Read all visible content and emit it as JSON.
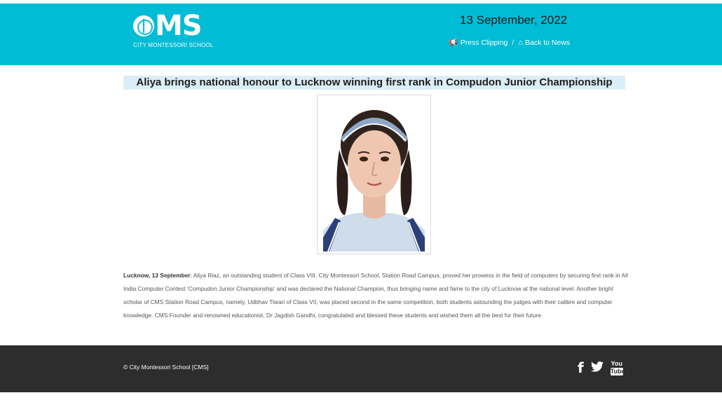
{
  "header": {
    "logo_text": "CMS",
    "logo_subtext": "CITY MONTESSORI SCHOOL",
    "date": "13 September, 2022",
    "nav": {
      "press_clipping": "Press Clipping",
      "separator": "/",
      "back_to_news": "Back to News"
    },
    "background_color": "#00bcd4"
  },
  "article": {
    "title": "Aliya brings national honour to Lucknow winning first rank in Compudon Junior Championship",
    "dateline": "Lucknow, 13 September",
    "body": ": Aliya Riaz, an outstanding student of Class VIII, City Montessori School, Station Road Campus, proved her prowess in the field of computers by securing first rank in All India Computer Contest ‘Compudon Junior Championship’ and was declared the National Champion, thus bringing name and fame to the city of Lucknow at the national level. Another bright scholar of CMS Station Road Campus, namely, Udbhav Tiwari of Class VII, was placed second in the same competition, both students astounding the judges with their calibre and computer knowledge. CMS Founder and renowned educationist, Dr Jagdish Gandhi, congratulated and blessed these students and wished them all the best for their future."
  },
  "footer": {
    "copyright": "© City Montessori School [CMS]",
    "social": {
      "facebook_icon": "f",
      "twitter_icon": "🐦",
      "youtube_top": "You",
      "youtube_bottom": "Tube"
    },
    "background_color": "#2d2d2d"
  }
}
